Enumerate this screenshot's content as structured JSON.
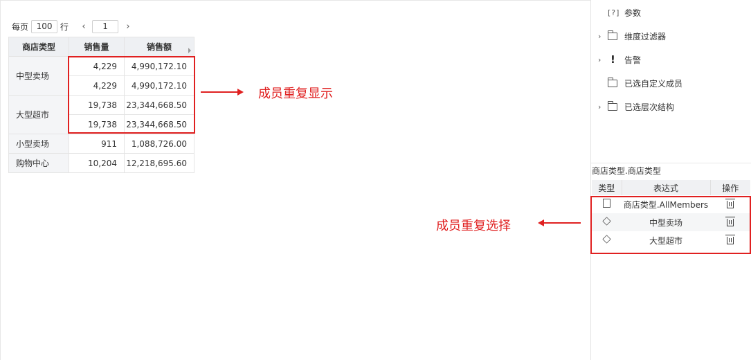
{
  "pager": {
    "prefix": "每页",
    "rows": "100",
    "suffix": "行",
    "prev": "‹",
    "page": "1",
    "next": "›"
  },
  "table": {
    "headers": [
      "商店类型",
      "销售量",
      "销售额"
    ],
    "rows": [
      {
        "dim": "中型卖场",
        "qty": "4,229",
        "amt": "4,990,172.10"
      },
      {
        "dim": "",
        "qty": "4,229",
        "amt": "4,990,172.10"
      },
      {
        "dim": "大型超市",
        "qty": "19,738",
        "amt": "23,344,668.50"
      },
      {
        "dim": "",
        "qty": "19,738",
        "amt": "23,344,668.50"
      },
      {
        "dim": "小型卖场",
        "qty": "911",
        "amt": "1,088,726.00"
      },
      {
        "dim": "购物中心",
        "qty": "10,204",
        "amt": "12,218,695.60"
      }
    ]
  },
  "annotations": {
    "duplicate_display": "成员重复显示",
    "duplicate_select": "成员重复选择"
  },
  "tree": [
    {
      "label": "参数",
      "icon": "bracket-question-icon",
      "expandable": false
    },
    {
      "label": "维度过滤器",
      "icon": "folder-icon",
      "expandable": true
    },
    {
      "label": "告警",
      "icon": "exclamation-icon",
      "expandable": true
    },
    {
      "label": "已选自定义成员",
      "icon": "folder-icon",
      "expandable": false
    },
    {
      "label": "已选层次结构",
      "icon": "folder-icon",
      "expandable": true
    }
  ],
  "tree_glyphs": {
    "bracket": "[?]",
    "excl": "!",
    "chevron": "›"
  },
  "member_panel": {
    "title": "商店类型.商店类型",
    "headers": [
      "类型",
      "表达式",
      "操作"
    ],
    "rows": [
      {
        "type_icon": "formula-icon",
        "expr": "商店类型.AllMembers"
      },
      {
        "type_icon": "cube-icon",
        "expr": "中型卖场"
      },
      {
        "type_icon": "cube-icon",
        "expr": "大型超市"
      }
    ]
  },
  "colors": {
    "accent_red": "#e02020",
    "header_bg": "#eef0f3"
  }
}
